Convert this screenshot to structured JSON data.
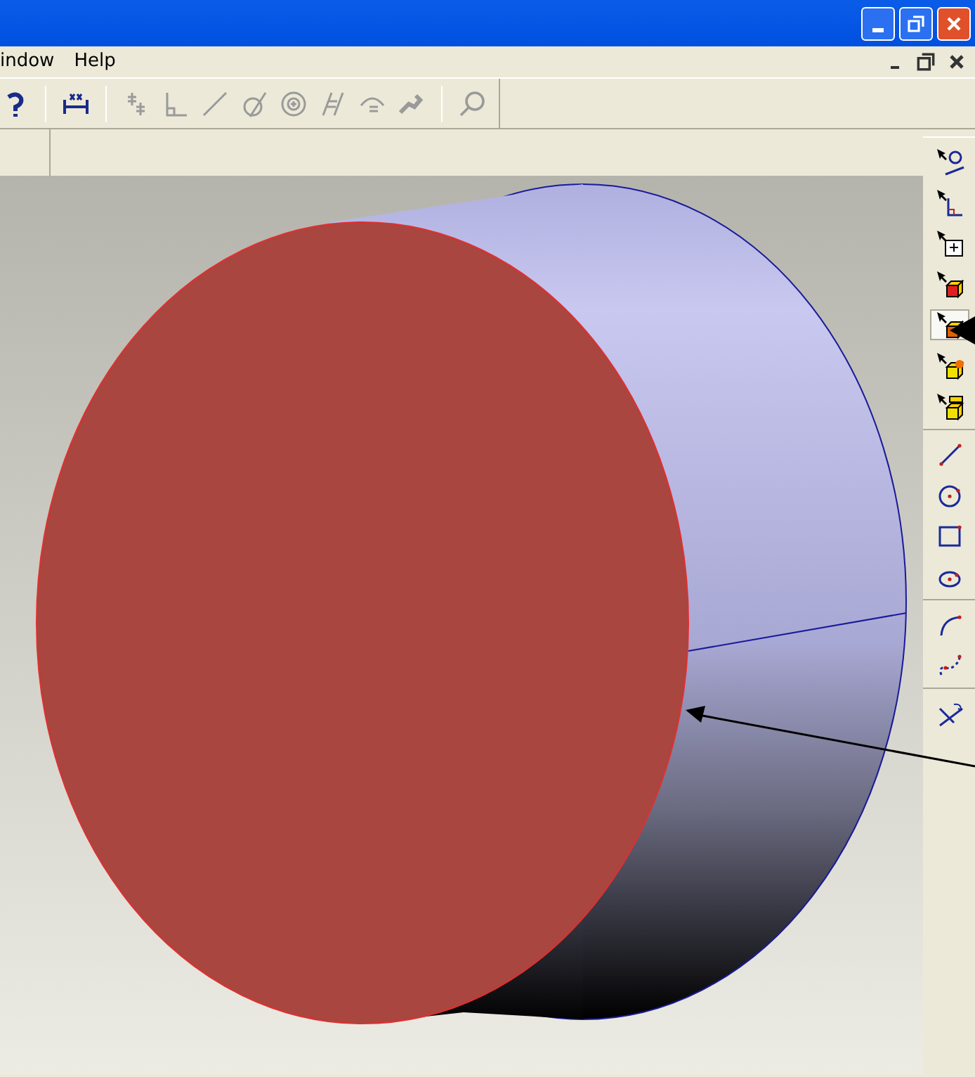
{
  "menu_bar": {
    "items": [
      {
        "label": "indow"
      },
      {
        "label": "Help"
      }
    ]
  },
  "right_toolbar": {
    "groups": [
      [
        {
          "selected": false
        },
        {
          "selected": false
        },
        {
          "selected": false
        },
        {
          "selected": false
        },
        {
          "selected": true
        },
        {
          "selected": false
        },
        {
          "selected": false
        }
      ],
      [
        {
          "selected": false
        },
        {
          "selected": false
        },
        {
          "selected": false
        },
        {
          "selected": false
        }
      ],
      [
        {
          "selected": false
        },
        {
          "selected": false
        }
      ],
      [
        {
          "selected": false
        }
      ]
    ]
  }
}
